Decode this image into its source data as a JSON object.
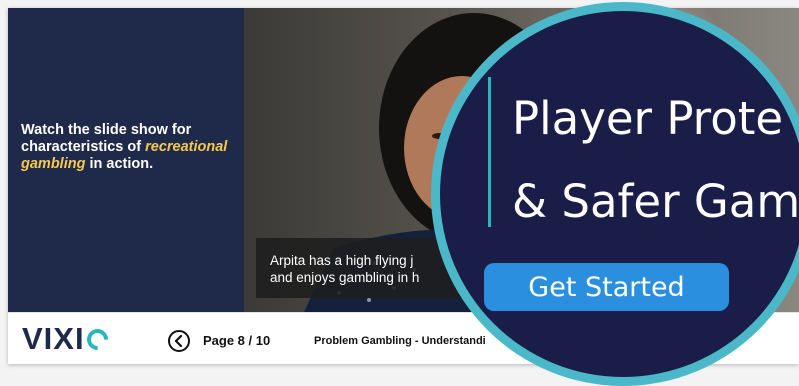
{
  "slide": {
    "intro": {
      "before": "Watch the slide show for characteristics of ",
      "highlight": "recreational gambling",
      "after": " in action."
    },
    "caption": {
      "line1": "Arpita has a high flying j",
      "line2": "and enjoys gambling in h"
    }
  },
  "footer": {
    "logo_text": "VIXI",
    "logo_icon": "o-ring-icon",
    "prev_icon": "chevron-left-circle-icon",
    "page_indicator": "Page 8 / 10",
    "course_title": "Problem Gambling - Understandi"
  },
  "magnifier": {
    "line1": "Player Prote",
    "line2": "& Safer Gam",
    "button_label": "Get Started"
  },
  "colors": {
    "navy": "#1f2a4a",
    "highlight": "#f6c94a",
    "teal": "#26b7c3",
    "button_blue": "#2a8fde",
    "magnifier_bg": "#1a1d47"
  }
}
